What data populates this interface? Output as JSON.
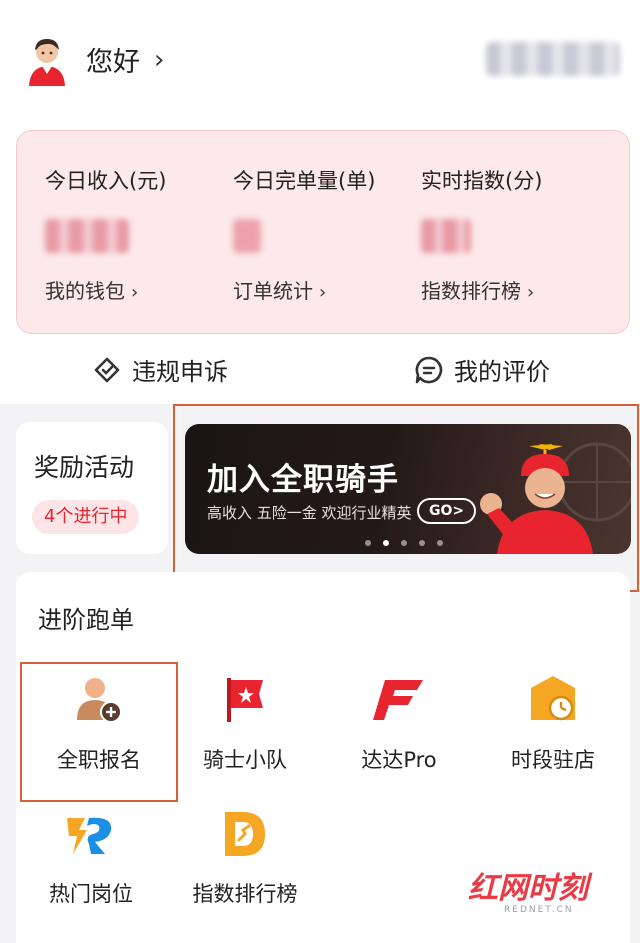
{
  "header": {
    "greeting": "您好",
    "greeting_chevron": "›",
    "avatar_icon": "rider-avatar-icon"
  },
  "stats": [
    {
      "label": "今日收入(元)",
      "link": "我的钱包"
    },
    {
      "label": "今日完单量(单)",
      "link": "订单统计"
    },
    {
      "label": "实时指数(分)",
      "link": "指数排行榜"
    }
  ],
  "quick_actions": {
    "appeal": "违规申诉",
    "reviews": "我的评价"
  },
  "reward": {
    "title": "奖励活动",
    "badge": "4个进行中"
  },
  "banner": {
    "title": "加入全职骑手",
    "subtitle": "高收入 五险一金 欢迎行业精英",
    "go": "GO>",
    "active_slide": 2,
    "slide_count": 5
  },
  "advance": {
    "title": "进阶跑单",
    "tiles": [
      {
        "label": "全职报名",
        "icon": "person-add-icon"
      },
      {
        "label": "骑士小队",
        "icon": "flag-icon"
      },
      {
        "label": "达达Pro",
        "icon": "pro-logo-icon"
      },
      {
        "label": "时段驻店",
        "icon": "shop-clock-icon"
      },
      {
        "label": "热门岗位",
        "icon": "jobs-icon"
      },
      {
        "label": "指数排行榜",
        "icon": "ranking-icon"
      }
    ]
  },
  "colors": {
    "accent": "#e8252f",
    "card_pink": "#fde8ea",
    "highlight_frame": "#d5603a",
    "icon_orange": "#f5a623"
  },
  "watermark": {
    "text": "红网时刻",
    "sub": "REDNET.CN"
  }
}
